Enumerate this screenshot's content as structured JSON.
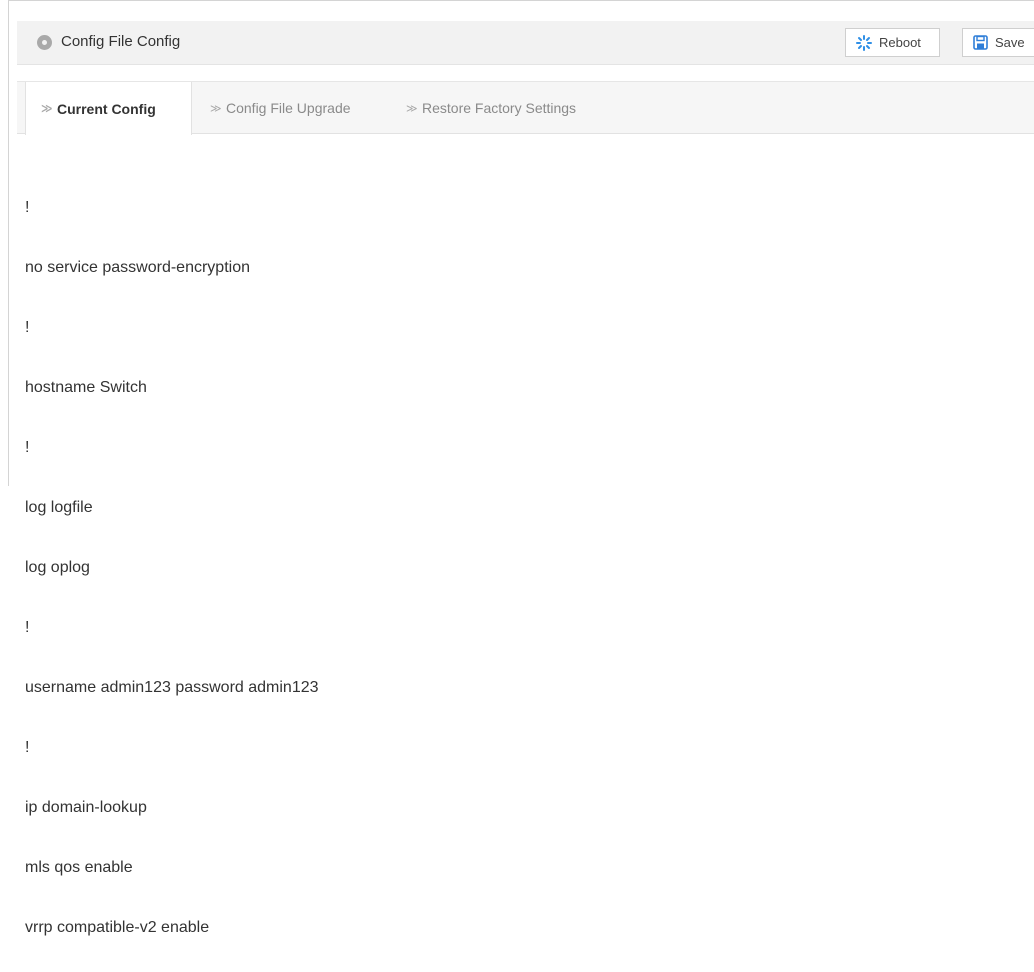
{
  "header": {
    "title": "Config File Config",
    "buttons": {
      "reboot_label": "Reboot",
      "save_label": "Save"
    }
  },
  "tabs": [
    {
      "label": "Current Config",
      "active": true
    },
    {
      "label": "Config File Upgrade",
      "active": false
    },
    {
      "label": "Restore Factory Settings",
      "active": false
    }
  ],
  "config_lines": [
    "!",
    "no service password-encryption",
    "!",
    "hostname Switch",
    "!",
    "log logfile",
    "log oplog",
    "!",
    "username admin123 password admin123",
    "!",
    "ip domain-lookup",
    "mls qos enable",
    "vrrp compatible-v2 enable",
    "!"
  ],
  "colors": {
    "reboot_icon": "#2f8fe6",
    "save_icon": "#2f7ed8",
    "header_bg": "#f2f2f2",
    "text": "#333333"
  },
  "icons": {
    "header": "circle-icon",
    "reboot": "spinner-icon",
    "save": "floppy-disk-icon",
    "tab": "chevron-right-icon"
  }
}
